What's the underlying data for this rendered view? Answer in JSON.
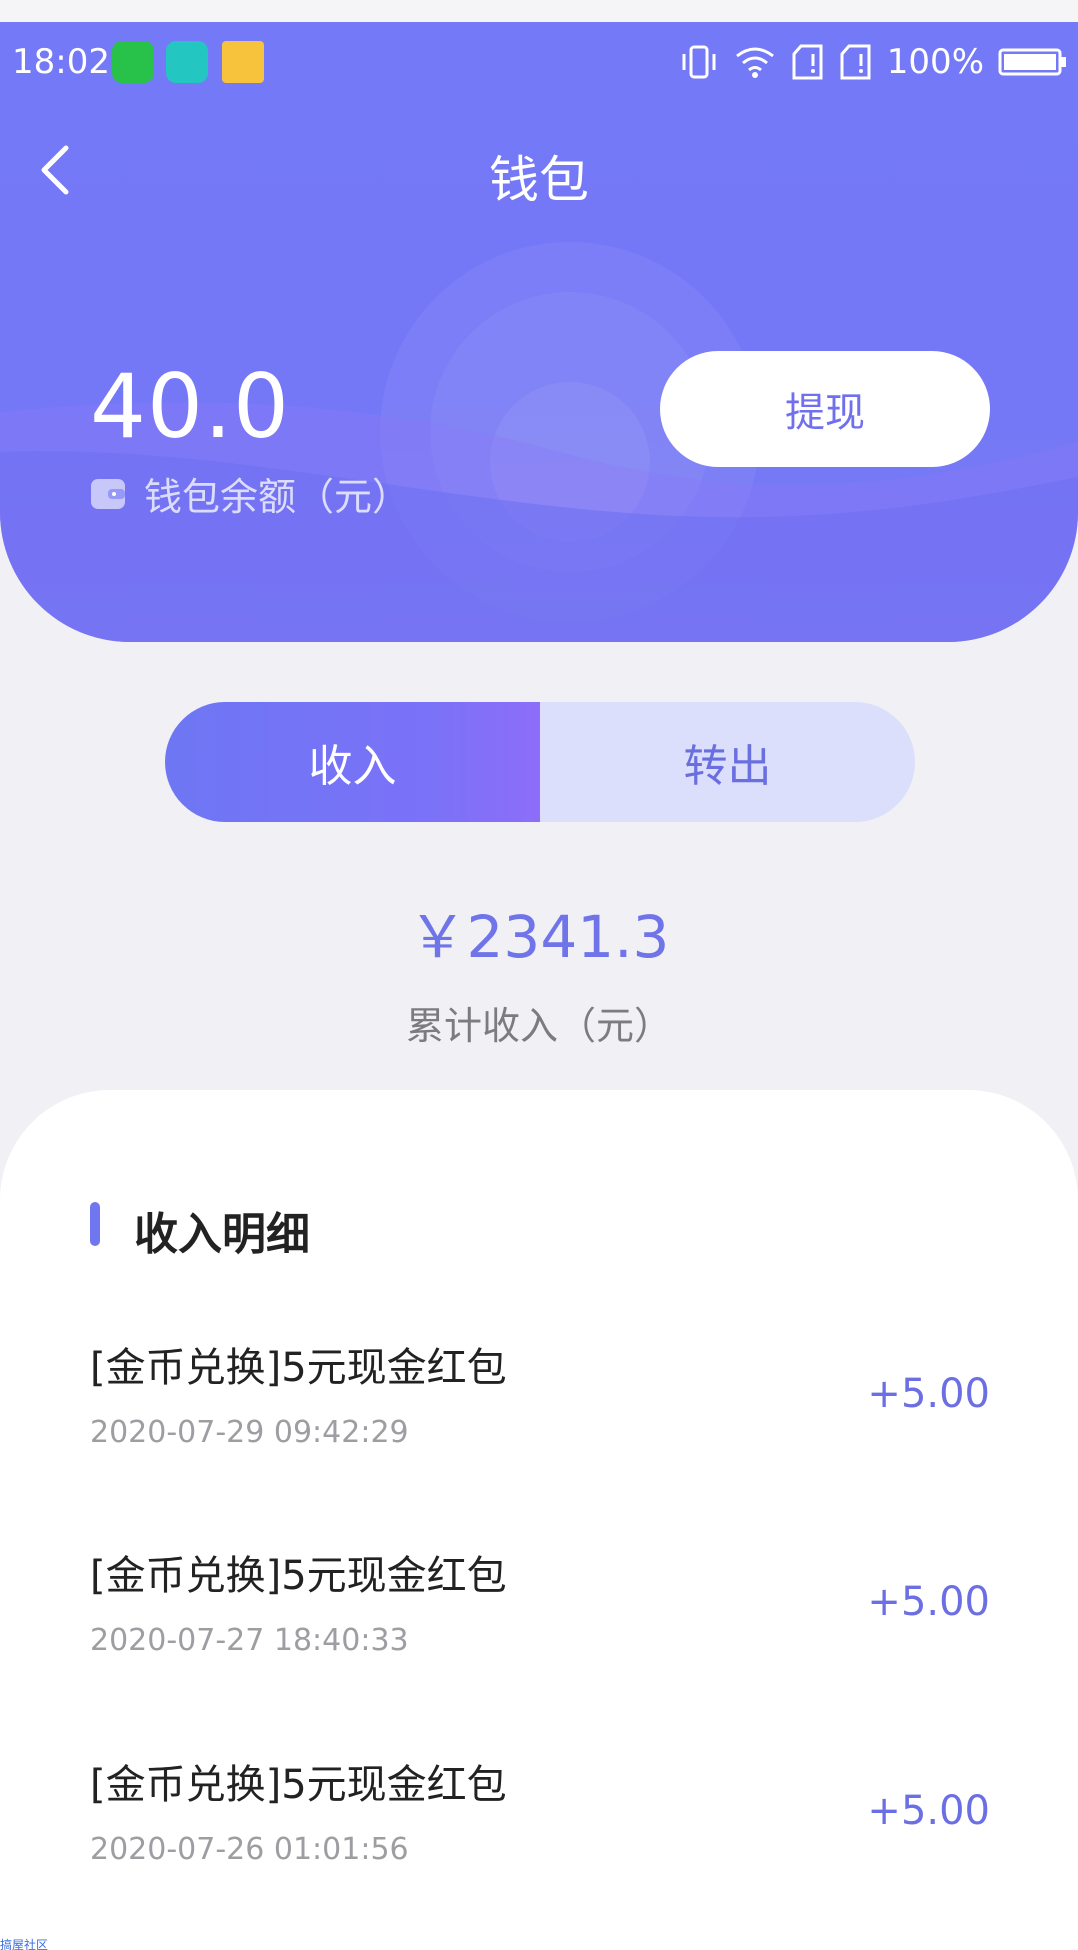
{
  "status_bar": {
    "time": "18:02",
    "battery": "100%",
    "icons": [
      "app-green-icon",
      "scan-icon",
      "folder-icon",
      "vibrate-icon",
      "wifi-icon",
      "sim1-icon",
      "sim2-icon",
      "battery-icon"
    ]
  },
  "nav": {
    "title": "钱包",
    "back_icon": "chevron-left-icon"
  },
  "balance": {
    "value": "40.0",
    "label": "钱包余额（元）",
    "icon": "wallet-icon"
  },
  "withdraw": {
    "label": "提现"
  },
  "tabs": [
    {
      "label": "收入",
      "active": true
    },
    {
      "label": "转出",
      "active": false
    }
  ],
  "summary": {
    "amount": "￥2341.3",
    "label": "累计收入（元）"
  },
  "detail": {
    "title": "收入明细",
    "records": [
      {
        "title": "[金币兑换]5元现金红包",
        "time": "2020-07-29 09:42:29",
        "amount": "+5.00"
      },
      {
        "title": "[金币兑换]5元现金红包",
        "time": "2020-07-27 18:40:33",
        "amount": "+5.00"
      },
      {
        "title": "[金币兑换]5元现金红包",
        "time": "2020-07-26 01:01:56",
        "amount": "+5.00"
      }
    ]
  },
  "watermark": "搞屋社区",
  "colors": {
    "accent": "#7479f7",
    "amount": "#6c6fe4",
    "tab_inactive": "#dcdffb"
  }
}
